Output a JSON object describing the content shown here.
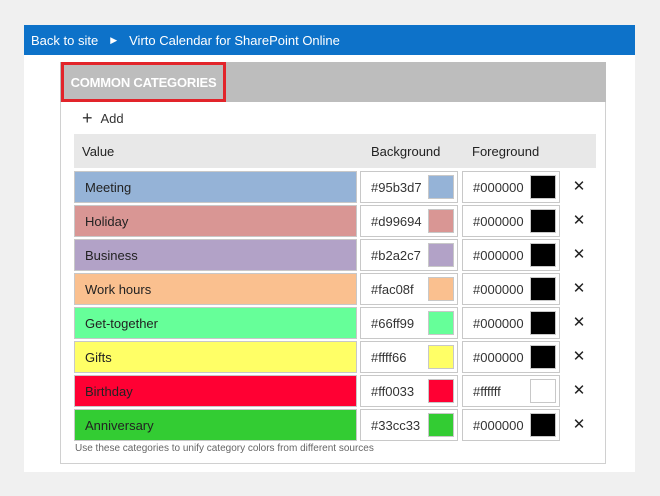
{
  "topbar": {
    "back_label": "Back to site",
    "app_label": "Virto Calendar for SharePoint Online"
  },
  "panel": {
    "title": "COMMON CATEGORIES",
    "add_label": "Add",
    "columns": {
      "value": "Value",
      "background": "Background",
      "foreground": "Foreground"
    },
    "note": "Use these categories to unify category colors from different sources"
  },
  "categories": [
    {
      "name": "Meeting",
      "background": "#95b3d7",
      "foreground": "#000000"
    },
    {
      "name": "Holiday",
      "background": "#d99694",
      "foreground": "#000000"
    },
    {
      "name": "Business",
      "background": "#b2a2c7",
      "foreground": "#000000"
    },
    {
      "name": "Work hours",
      "background": "#fac08f",
      "foreground": "#000000"
    },
    {
      "name": "Get-together",
      "background": "#66ff99",
      "foreground": "#000000"
    },
    {
      "name": "Gifts",
      "background": "#ffff66",
      "foreground": "#000000"
    },
    {
      "name": "Birthday",
      "background": "#ff0033",
      "foreground": "#ffffff"
    },
    {
      "name": "Anniversary",
      "background": "#33cc33",
      "foreground": "#000000"
    }
  ],
  "icons": {
    "add": "plus-icon",
    "delete": "close-icon",
    "separator": "chevron-right-icon"
  }
}
